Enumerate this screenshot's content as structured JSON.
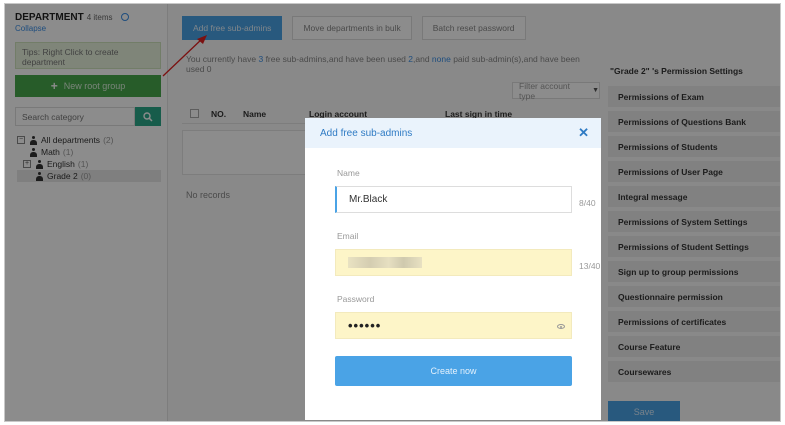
{
  "sidebar": {
    "title": "DEPARTMENT",
    "count": "4 items",
    "collapse_label": "Collapse",
    "tips": "Tips: Right Click to create department",
    "new_root_label": "New root group",
    "search_placeholder": "Search category",
    "tree": [
      {
        "label": "All departments",
        "count": "(2)"
      },
      {
        "label": "Math",
        "count": "(1)"
      },
      {
        "label": "English",
        "count": "(1)"
      },
      {
        "label": "Grade 2",
        "count": "(0)"
      }
    ]
  },
  "toolbar": {
    "add_label": "Add free sub-admins",
    "move_label": "Move departments in bulk",
    "reset_label": "Batch reset password"
  },
  "info": {
    "prefix": "You currently have ",
    "free_count": "3",
    "middle": " free sub-admins,and have been used ",
    "used_count": "2",
    "and": ",and ",
    "paid": "none",
    "suffix": " paid sub-admin(s),and have been used 0"
  },
  "filter": {
    "label": "Filter account type"
  },
  "table": {
    "headers": [
      "NO.",
      "Name",
      "Login account",
      "Last sign in time"
    ],
    "empty_text": "No records"
  },
  "permissions": {
    "title": "\"Grade 2\" 's Permission Settings",
    "items": [
      "Permissions of Exam",
      "Permissions of Questions Bank",
      "Permissions of Students",
      "Permissions of User Page",
      "Integral message",
      "Permissions of System Settings",
      "Permissions of Student Settings",
      "Sign up to group permissions",
      "Questionnaire permission",
      "Permissions of certificates",
      "Course Feature",
      "Coursewares"
    ],
    "save_label": "Save"
  },
  "modal": {
    "title": "Add free sub-admins",
    "name_label": "Name",
    "name_value": "Mr.Black",
    "name_counter": "8/40",
    "email_label": "Email",
    "email_counter": "13/40",
    "password_label": "Password",
    "password_value": "••••••",
    "submit_label": "Create now"
  },
  "colors": {
    "accent": "#4aa3e6",
    "green": "#48a84b",
    "teal": "#2aa889",
    "arrow": "#e02020"
  }
}
